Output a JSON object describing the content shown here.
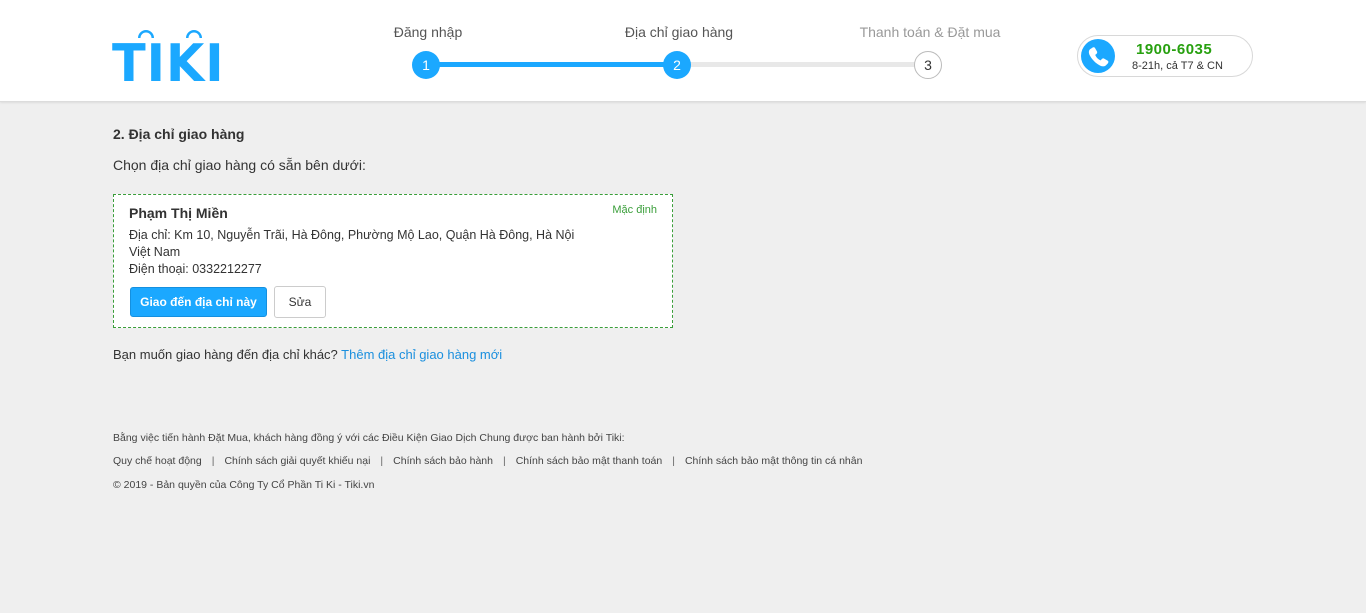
{
  "header": {
    "logo_text": "TIKI",
    "steps": [
      {
        "number": "1",
        "label": "Đăng nhập",
        "state": "done"
      },
      {
        "number": "2",
        "label": "Địa chỉ giao hàng",
        "state": "current"
      },
      {
        "number": "3",
        "label": "Thanh toán & Đặt mua",
        "state": "pending"
      }
    ],
    "hotline": {
      "number": "1900-6035",
      "hours": "8-21h, cả T7 & CN"
    }
  },
  "main": {
    "section_title": "2. Địa chỉ giao hàng",
    "section_subtitle": "Chọn địa chỉ giao hàng có sẵn bên dưới:",
    "address_card": {
      "name": "Phạm Thị Miền",
      "default_tag": "Mặc định",
      "address": "Địa chỉ: Km 10, Nguyễn Trãi, Hà Đông, Phường Mộ Lao, Quận Hà Đông, Hà Nội Việt Nam",
      "phone": "Điện thoại: 0332212277",
      "deliver_button": "Giao đến địa chỉ này",
      "edit_button": "Sửa"
    },
    "other_address_prompt": "Bạn muốn giao hàng đến địa chỉ khác?",
    "add_address_link": "Thêm địa chỉ giao hàng mới"
  },
  "footer": {
    "terms_text": "Bằng việc tiến hành Đặt Mua, khách hàng đồng ý với các Điều Kiện Giao Dịch Chung được ban hành bởi Tiki:",
    "links": [
      "Quy chế hoạt động",
      "Chính sách giải quyết khiếu nại",
      "Chính sách bảo hành",
      "Chính sách bảo mật thanh toán",
      "Chính sách bảo mật thông tin cá nhân"
    ],
    "link_separator": "|",
    "copyright": "© 2019 - Bản quyền của Công Ty Cổ Phần Ti Ki - Tiki.vn"
  },
  "colors": {
    "brand_blue": "#1ba8ff",
    "hotline_green": "#27a00f",
    "default_tag_green": "#3a9e3a",
    "link_blue": "#1a8fde",
    "background": "#efefef"
  }
}
